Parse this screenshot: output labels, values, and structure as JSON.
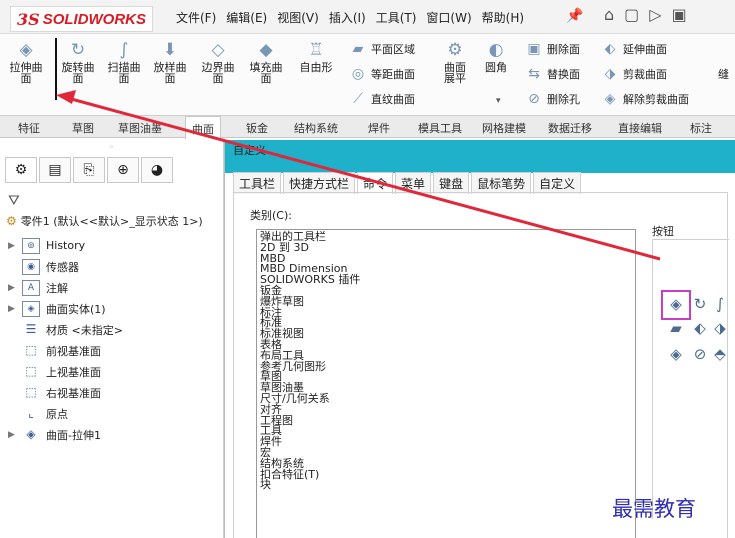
{
  "app": {
    "logo_ds": "3S",
    "logo_name": "SOLIDWORKS",
    "menu": [
      "文件(F)",
      "编辑(E)",
      "视图(V)",
      "插入(I)",
      "工具(T)",
      "窗口(W)",
      "帮助(H)"
    ],
    "quick_access": [
      "home-icon",
      "new-document-icon",
      "open-icon",
      "save-icon"
    ]
  },
  "ribbon": {
    "big_buttons": [
      {
        "label": "拉伸曲面",
        "icon": "extruded-surface-icon"
      },
      {
        "label": "旋转曲面",
        "icon": "revolved-surface-icon"
      },
      {
        "label": "扫描曲面",
        "icon": "swept-surface-icon"
      },
      {
        "label": "放样曲面",
        "icon": "lofted-surface-icon"
      },
      {
        "label": "边界曲面",
        "icon": "boundary-surface-icon"
      },
      {
        "label": "填充曲面",
        "icon": "filled-surface-icon"
      },
      {
        "label": "自由形",
        "icon": "freeform-icon"
      }
    ],
    "col1": [
      "平面区域",
      "等距曲面",
      "直纹曲面"
    ],
    "flatten": "曲面展平",
    "fillet": "圆角",
    "col2": [
      "删除面",
      "替换面",
      "删除孔"
    ],
    "col3": [
      "延伸曲面",
      "剪裁曲面",
      "解除剪裁曲面"
    ],
    "overflow_label": "缝"
  },
  "tabs": [
    "特征",
    "草图",
    "草图油墨",
    "曲面",
    "钣金",
    "结构系统",
    "焊件",
    "模具工具",
    "网格建模",
    "数据迁移",
    "直接编辑",
    "标注"
  ],
  "feature_tree": {
    "part": "零件1 (默认<<默认>_显示状态 1>)",
    "nodes": [
      {
        "label": "History",
        "expand": true
      },
      {
        "label": "传感器",
        "expand": false
      },
      {
        "label": "注解",
        "expand": true
      },
      {
        "label": "曲面实体(1)",
        "expand": true
      },
      {
        "label": "材质 <未指定>",
        "expand": false
      },
      {
        "label": "前视基准面",
        "expand": false
      },
      {
        "label": "上视基准面",
        "expand": false
      },
      {
        "label": "右视基准面",
        "expand": false
      },
      {
        "label": "原点",
        "expand": false
      },
      {
        "label": "曲面-拉伸1",
        "expand": true
      }
    ]
  },
  "dialog": {
    "title": "自定义",
    "tabs": [
      "工具栏",
      "快捷方式栏",
      "命令",
      "菜单",
      "键盘",
      "鼠标笔势",
      "自定义"
    ],
    "active_tab": "命令",
    "category_label": "类别(C):",
    "categories": [
      "弹出的工具栏",
      "2D 到 3D",
      "MBD",
      "MBD Dimension",
      "SOLIDWORKS 插件",
      "钣金",
      "爆炸草图",
      "标注",
      "标准",
      "标准视图",
      "表格",
      "布局工具",
      "参考几何图形",
      "草图",
      "草图油墨",
      "尺寸/几何关系",
      "对齐",
      "工程图",
      "工具",
      "焊件",
      "宏",
      "结构系统",
      "扣合特征(T)",
      "块"
    ],
    "buttons_label": "按钮"
  },
  "watermark": "最需教育"
}
